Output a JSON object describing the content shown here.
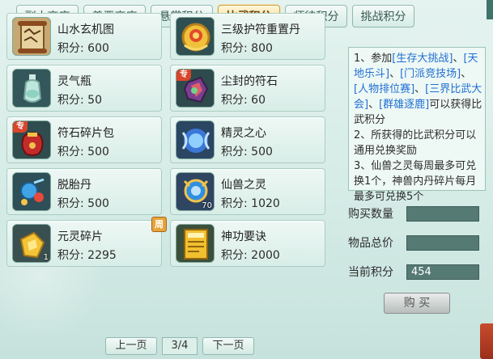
{
  "tabs": [
    {
      "label": "副本商店",
      "active": false
    },
    {
      "label": "善恶商店",
      "active": false
    },
    {
      "label": "悬赏积分",
      "active": false
    },
    {
      "label": "比武积分",
      "active": true
    },
    {
      "label": "师徒积分",
      "active": false
    },
    {
      "label": "挑战积分",
      "active": false
    }
  ],
  "items": [
    {
      "name": "山水玄机图",
      "price": "积分: 600",
      "icon": "scroll-map-icon"
    },
    {
      "name": "三级护符重置丹",
      "price": "积分: 800",
      "icon": "golden-pill-icon"
    },
    {
      "name": "灵气瓶",
      "price": "积分: 50",
      "icon": "spirit-bottle-icon"
    },
    {
      "name": "尘封的符石",
      "price": "积分: 60",
      "icon": "rune-stone-icon",
      "tag": "专"
    },
    {
      "name": "符石碎片包",
      "price": "积分: 500",
      "icon": "rune-pouch-icon",
      "tag": "专"
    },
    {
      "name": "精灵之心",
      "price": "积分: 500",
      "icon": "spirit-heart-icon"
    },
    {
      "name": "脱胎丹",
      "price": "积分: 500",
      "icon": "rebirth-pill-icon"
    },
    {
      "name": "仙兽之灵",
      "price": "积分: 1020",
      "icon": "beast-orb-icon",
      "qty": "70"
    },
    {
      "name": "元灵碎片",
      "price": "积分: 2295",
      "icon": "spirit-shard-icon",
      "qty": "1",
      "weekly": "周"
    },
    {
      "name": "神功要诀",
      "price": "积分: 2000",
      "icon": "skill-book-icon"
    }
  ],
  "info": {
    "p1_a": "1、参加",
    "p1_b": "[生存大挑战]",
    "p1_c": "、",
    "p1_d": "[天地乐斗]",
    "p1_e": "、",
    "p1_f": "[门派竞技场]",
    "p1_g": "、",
    "p1_h": "[人物排位赛]",
    "p1_i": "、",
    "p1_j": "[三界比武大会]",
    "p1_k": "、",
    "p1_l": "[群雄逐鹿]",
    "p1_m": "可以获得比武积分",
    "p2": "2、所获得的比武积分可以通用兑换奖励",
    "p3": "3、仙兽之灵每周最多可兑换1个，神兽内丹碎片每月最多可兑换5个"
  },
  "purchase": {
    "qty_label": "购买数量",
    "qty_value": "",
    "total_label": "物品总价",
    "total_value": "",
    "points_label": "当前积分",
    "points_value": "454",
    "buy_label": "购 买"
  },
  "pager": {
    "prev": "上一页",
    "page": "3/4",
    "next": "下一页"
  }
}
